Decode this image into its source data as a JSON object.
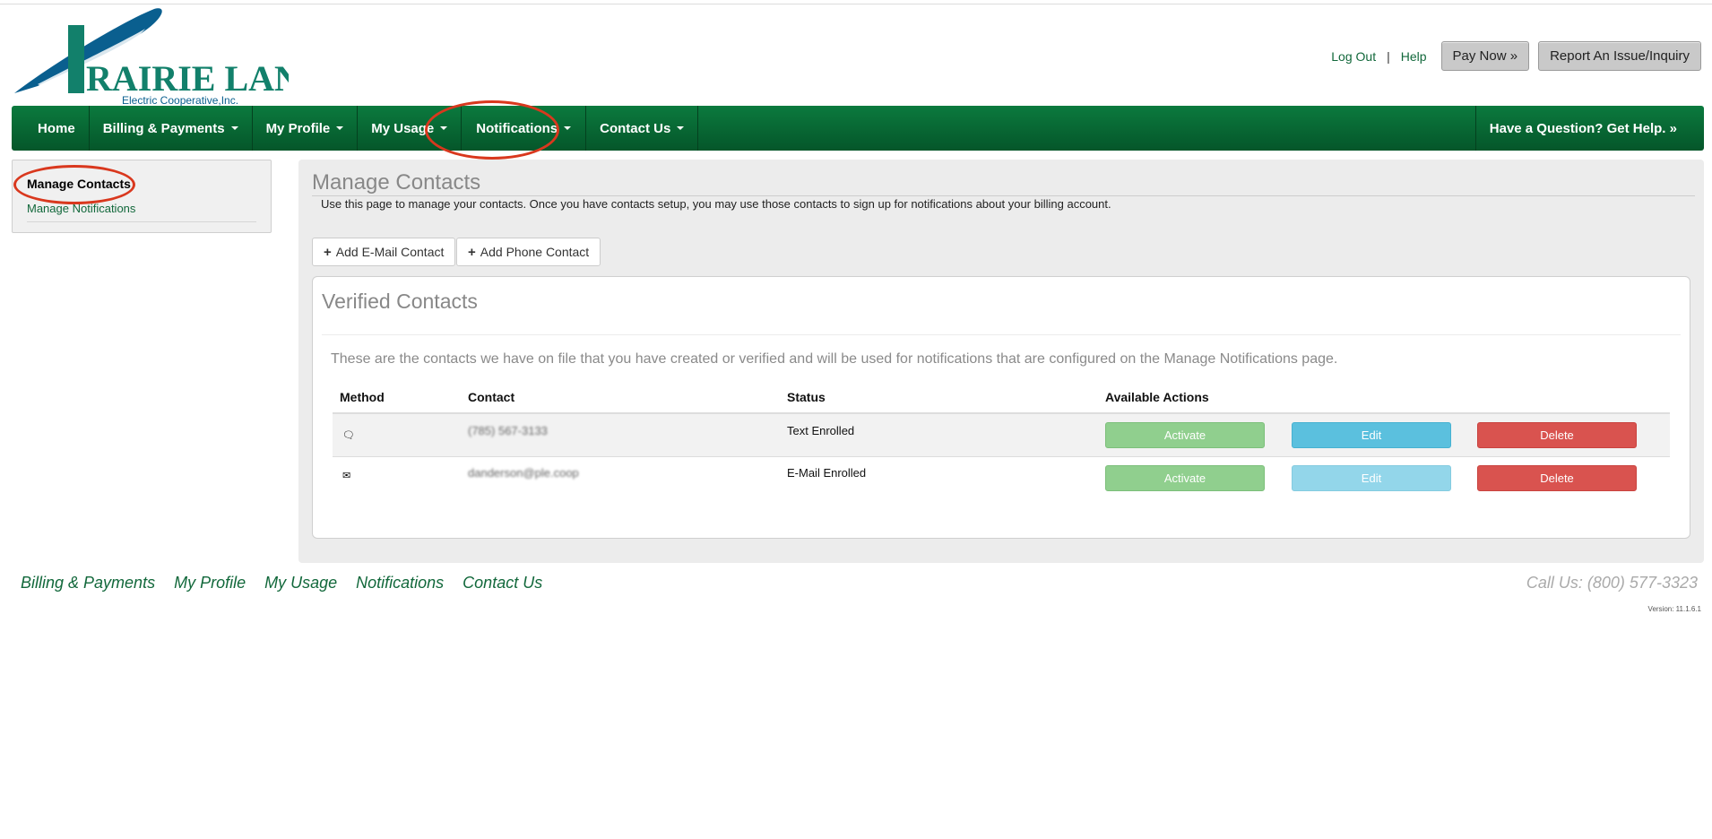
{
  "brand": {
    "name": "PRAIRIE LAND",
    "tagline": "Electric Cooperative,Inc.",
    "colors": {
      "primary_green": "#0b7a3e",
      "logo_blue": "#0a5f8f",
      "logo_teal": "#12806b"
    }
  },
  "header": {
    "logout": "Log Out",
    "separator": "|",
    "help": "Help",
    "pay_now": "Pay Now »",
    "report": "Report An Issue/Inquiry"
  },
  "nav": {
    "items": [
      {
        "label": "Home",
        "dropdown": false
      },
      {
        "label": "Billing & Payments",
        "dropdown": true
      },
      {
        "label": "My Profile",
        "dropdown": true
      },
      {
        "label": "My Usage",
        "dropdown": true
      },
      {
        "label": "Notifications",
        "dropdown": true,
        "highlighted": true
      },
      {
        "label": "Contact Us",
        "dropdown": true
      }
    ],
    "help": "Have a Question? Get Help. »"
  },
  "sidebar": {
    "items": [
      {
        "label": "Manage Contacts",
        "active": true
      },
      {
        "label": "Manage Notifications",
        "active": false
      }
    ]
  },
  "main": {
    "title": "Manage Contacts",
    "intro": "Use this page to manage your contacts. Once you have contacts setup, you may use those contacts to sign up for notifications about your billing account.",
    "add_email": "Add E-Mail Contact",
    "add_phone": "Add Phone Contact",
    "verified": {
      "title": "Verified Contacts",
      "description": "These are the contacts we have on file that you have created or verified and will be used for notifications that are configured on the Manage Notifications page.",
      "columns": [
        "Method",
        "Contact",
        "Status",
        "Available Actions"
      ],
      "rows": [
        {
          "method_icon": "comment-icon",
          "contact": "(785) 567-3133",
          "status": "Text Enrolled",
          "activate": "Activate",
          "edit": "Edit",
          "delete": "Delete"
        },
        {
          "method_icon": "envelope-icon",
          "contact": "danderson@ple.coop",
          "status": "E-Mail Enrolled",
          "activate": "Activate",
          "edit": "Edit",
          "delete": "Delete"
        }
      ]
    }
  },
  "footer": {
    "links": [
      "Billing & Payments",
      "My Profile",
      "My Usage",
      "Notifications",
      "Contact Us"
    ],
    "call": "Call Us: (800) 577-3323",
    "version": "Version: 11.1.6.1"
  }
}
